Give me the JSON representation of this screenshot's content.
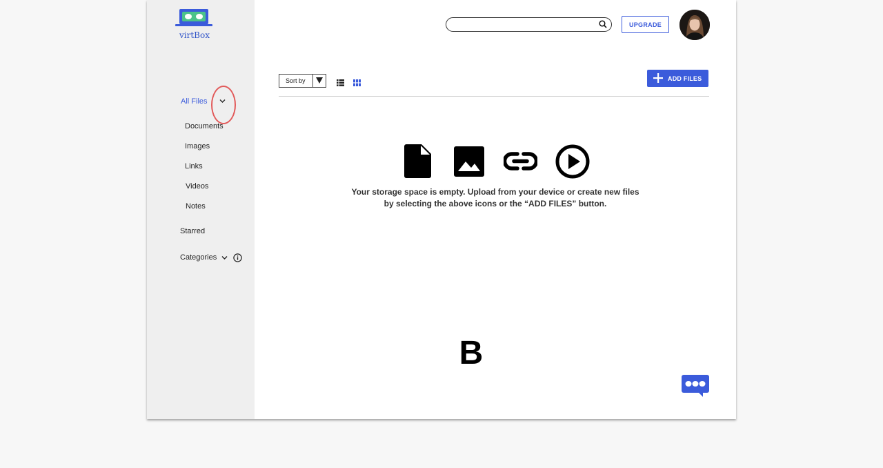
{
  "app": {
    "name": "virtBox"
  },
  "header": {
    "search_value": "",
    "upgrade_label": "UPGRADE"
  },
  "sidebar": {
    "all_files": "All Files",
    "items": [
      "Documents",
      "Images",
      "Links",
      "Videos",
      "Notes"
    ],
    "starred": "Starred",
    "categories": "Categories"
  },
  "toolbar": {
    "sort_label": "Sort by",
    "add_files_label": "ADD FILES"
  },
  "empty_state": {
    "line1": "Your storage space is empty. Upload from your device or create new files",
    "line2": "by selecting the above icons or the “ADD FILES” button."
  },
  "overlay_letter": "B",
  "colors": {
    "accent": "#3b5bdb",
    "sidebar_bg": "#efefef",
    "annotation": "#e25b5b",
    "logo_green": "#4cc38a"
  },
  "icons": [
    "logo-icon",
    "chevron-down-icon",
    "info-icon",
    "search-icon",
    "list-view-icon",
    "grid-view-icon",
    "plus-icon",
    "document-icon",
    "image-icon",
    "link-icon",
    "play-icon",
    "chat-icon"
  ]
}
